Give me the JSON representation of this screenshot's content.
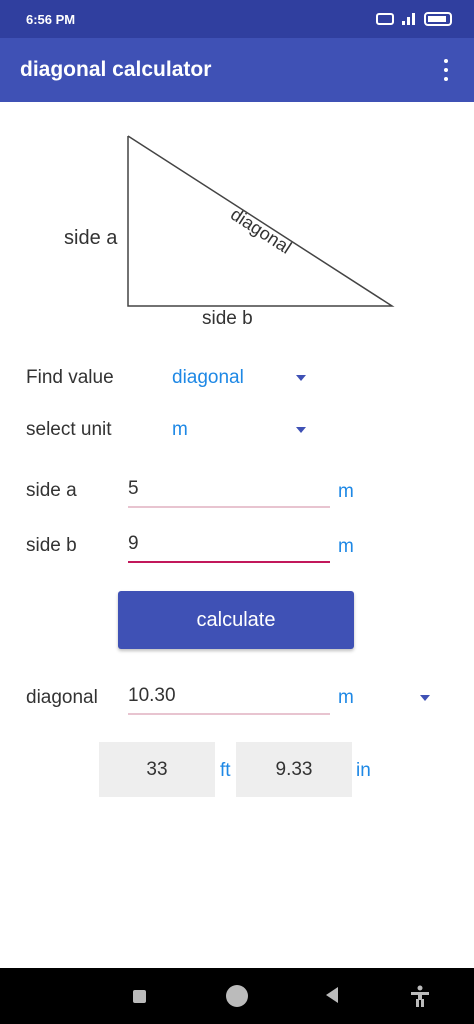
{
  "status_bar": {
    "time": "6:56 PM",
    "icons": [
      "notification-icon",
      "signal-icon",
      "battery-icon"
    ]
  },
  "app_bar": {
    "title": "diagonal calculator",
    "menu_icon": "more-vert-icon"
  },
  "diagram": {
    "side_a_label": "side a",
    "side_b_label": "side b",
    "diagonal_label": "diagonal"
  },
  "find_value": {
    "label": "Find value",
    "selected": "diagonal"
  },
  "select_unit": {
    "label": "select unit",
    "selected": "m"
  },
  "side_a": {
    "label": "side a",
    "value": "5",
    "unit": "m"
  },
  "side_b": {
    "label": "side b",
    "value": "9",
    "unit": "m"
  },
  "calculate_button": {
    "label": "calculate"
  },
  "result": {
    "label": "diagonal",
    "value": "10.30",
    "unit": "m"
  },
  "conversion": {
    "feet_value": "33",
    "feet_unit": "ft",
    "inch_value": "9.33",
    "inch_unit": "in"
  },
  "colors": {
    "app_bar": "#3f51b5",
    "status_bar": "#303f9f",
    "accent": "#1e88e5",
    "field_focus": "#c2185b"
  }
}
